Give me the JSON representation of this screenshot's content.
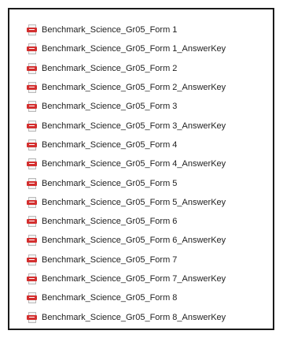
{
  "files": [
    {
      "name": "Benchmark_Science_Gr05_Form 1",
      "icon": "pdf-file-icon"
    },
    {
      "name": "Benchmark_Science_Gr05_Form 1_AnswerKey",
      "icon": "pdf-file-icon"
    },
    {
      "name": "Benchmark_Science_Gr05_Form 2",
      "icon": "pdf-file-icon"
    },
    {
      "name": "Benchmark_Science_Gr05_Form 2_AnswerKey",
      "icon": "pdf-file-icon"
    },
    {
      "name": "Benchmark_Science_Gr05_Form 3",
      "icon": "pdf-file-icon"
    },
    {
      "name": "Benchmark_Science_Gr05_Form 3_AnswerKey",
      "icon": "pdf-file-icon"
    },
    {
      "name": "Benchmark_Science_Gr05_Form 4",
      "icon": "pdf-file-icon"
    },
    {
      "name": "Benchmark_Science_Gr05_Form 4_AnswerKey",
      "icon": "pdf-file-icon"
    },
    {
      "name": "Benchmark_Science_Gr05_Form 5",
      "icon": "pdf-file-icon"
    },
    {
      "name": "Benchmark_Science_Gr05_Form 5_AnswerKey",
      "icon": "pdf-file-icon"
    },
    {
      "name": "Benchmark_Science_Gr05_Form 6",
      "icon": "pdf-file-icon"
    },
    {
      "name": "Benchmark_Science_Gr05_Form 6_AnswerKey",
      "icon": "pdf-file-icon"
    },
    {
      "name": "Benchmark_Science_Gr05_Form 7",
      "icon": "pdf-file-icon"
    },
    {
      "name": "Benchmark_Science_Gr05_Form 7_AnswerKey",
      "icon": "pdf-file-icon"
    },
    {
      "name": "Benchmark_Science_Gr05_Form 8",
      "icon": "pdf-file-icon"
    },
    {
      "name": "Benchmark_Science_Gr05_Form 8_AnswerKey",
      "icon": "pdf-file-icon"
    }
  ],
  "colors": {
    "pdf_icon": "#d32f2f",
    "text": "#1f1f1f",
    "border": "#1a1a1a"
  }
}
